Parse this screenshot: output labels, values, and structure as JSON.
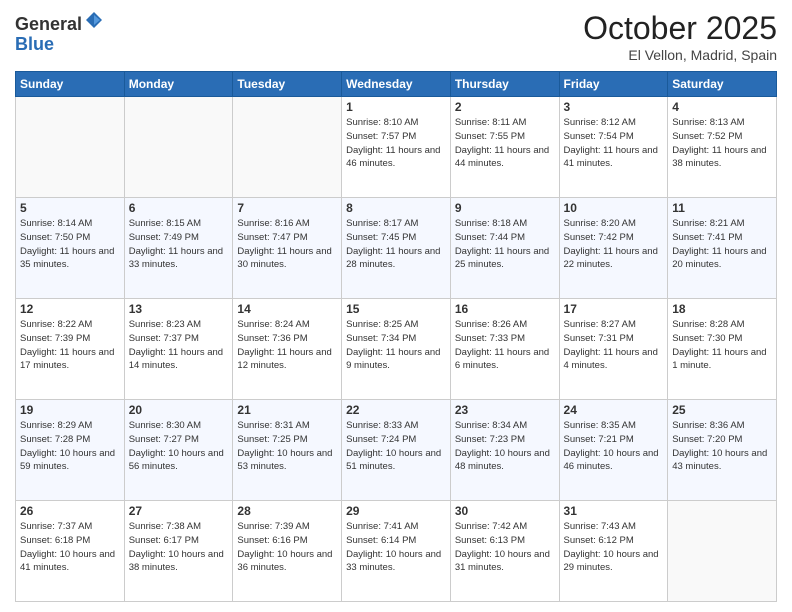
{
  "header": {
    "logo_line1": "General",
    "logo_line2": "Blue",
    "month": "October 2025",
    "location": "El Vellon, Madrid, Spain"
  },
  "weekdays": [
    "Sunday",
    "Monday",
    "Tuesday",
    "Wednesday",
    "Thursday",
    "Friday",
    "Saturday"
  ],
  "weeks": [
    [
      {
        "day": "",
        "info": ""
      },
      {
        "day": "",
        "info": ""
      },
      {
        "day": "",
        "info": ""
      },
      {
        "day": "1",
        "info": "Sunrise: 8:10 AM\nSunset: 7:57 PM\nDaylight: 11 hours and 46 minutes."
      },
      {
        "day": "2",
        "info": "Sunrise: 8:11 AM\nSunset: 7:55 PM\nDaylight: 11 hours and 44 minutes."
      },
      {
        "day": "3",
        "info": "Sunrise: 8:12 AM\nSunset: 7:54 PM\nDaylight: 11 hours and 41 minutes."
      },
      {
        "day": "4",
        "info": "Sunrise: 8:13 AM\nSunset: 7:52 PM\nDaylight: 11 hours and 38 minutes."
      }
    ],
    [
      {
        "day": "5",
        "info": "Sunrise: 8:14 AM\nSunset: 7:50 PM\nDaylight: 11 hours and 35 minutes."
      },
      {
        "day": "6",
        "info": "Sunrise: 8:15 AM\nSunset: 7:49 PM\nDaylight: 11 hours and 33 minutes."
      },
      {
        "day": "7",
        "info": "Sunrise: 8:16 AM\nSunset: 7:47 PM\nDaylight: 11 hours and 30 minutes."
      },
      {
        "day": "8",
        "info": "Sunrise: 8:17 AM\nSunset: 7:45 PM\nDaylight: 11 hours and 28 minutes."
      },
      {
        "day": "9",
        "info": "Sunrise: 8:18 AM\nSunset: 7:44 PM\nDaylight: 11 hours and 25 minutes."
      },
      {
        "day": "10",
        "info": "Sunrise: 8:20 AM\nSunset: 7:42 PM\nDaylight: 11 hours and 22 minutes."
      },
      {
        "day": "11",
        "info": "Sunrise: 8:21 AM\nSunset: 7:41 PM\nDaylight: 11 hours and 20 minutes."
      }
    ],
    [
      {
        "day": "12",
        "info": "Sunrise: 8:22 AM\nSunset: 7:39 PM\nDaylight: 11 hours and 17 minutes."
      },
      {
        "day": "13",
        "info": "Sunrise: 8:23 AM\nSunset: 7:37 PM\nDaylight: 11 hours and 14 minutes."
      },
      {
        "day": "14",
        "info": "Sunrise: 8:24 AM\nSunset: 7:36 PM\nDaylight: 11 hours and 12 minutes."
      },
      {
        "day": "15",
        "info": "Sunrise: 8:25 AM\nSunset: 7:34 PM\nDaylight: 11 hours and 9 minutes."
      },
      {
        "day": "16",
        "info": "Sunrise: 8:26 AM\nSunset: 7:33 PM\nDaylight: 11 hours and 6 minutes."
      },
      {
        "day": "17",
        "info": "Sunrise: 8:27 AM\nSunset: 7:31 PM\nDaylight: 11 hours and 4 minutes."
      },
      {
        "day": "18",
        "info": "Sunrise: 8:28 AM\nSunset: 7:30 PM\nDaylight: 11 hours and 1 minute."
      }
    ],
    [
      {
        "day": "19",
        "info": "Sunrise: 8:29 AM\nSunset: 7:28 PM\nDaylight: 10 hours and 59 minutes."
      },
      {
        "day": "20",
        "info": "Sunrise: 8:30 AM\nSunset: 7:27 PM\nDaylight: 10 hours and 56 minutes."
      },
      {
        "day": "21",
        "info": "Sunrise: 8:31 AM\nSunset: 7:25 PM\nDaylight: 10 hours and 53 minutes."
      },
      {
        "day": "22",
        "info": "Sunrise: 8:33 AM\nSunset: 7:24 PM\nDaylight: 10 hours and 51 minutes."
      },
      {
        "day": "23",
        "info": "Sunrise: 8:34 AM\nSunset: 7:23 PM\nDaylight: 10 hours and 48 minutes."
      },
      {
        "day": "24",
        "info": "Sunrise: 8:35 AM\nSunset: 7:21 PM\nDaylight: 10 hours and 46 minutes."
      },
      {
        "day": "25",
        "info": "Sunrise: 8:36 AM\nSunset: 7:20 PM\nDaylight: 10 hours and 43 minutes."
      }
    ],
    [
      {
        "day": "26",
        "info": "Sunrise: 7:37 AM\nSunset: 6:18 PM\nDaylight: 10 hours and 41 minutes."
      },
      {
        "day": "27",
        "info": "Sunrise: 7:38 AM\nSunset: 6:17 PM\nDaylight: 10 hours and 38 minutes."
      },
      {
        "day": "28",
        "info": "Sunrise: 7:39 AM\nSunset: 6:16 PM\nDaylight: 10 hours and 36 minutes."
      },
      {
        "day": "29",
        "info": "Sunrise: 7:41 AM\nSunset: 6:14 PM\nDaylight: 10 hours and 33 minutes."
      },
      {
        "day": "30",
        "info": "Sunrise: 7:42 AM\nSunset: 6:13 PM\nDaylight: 10 hours and 31 minutes."
      },
      {
        "day": "31",
        "info": "Sunrise: 7:43 AM\nSunset: 6:12 PM\nDaylight: 10 hours and 29 minutes."
      },
      {
        "day": "",
        "info": ""
      }
    ]
  ]
}
